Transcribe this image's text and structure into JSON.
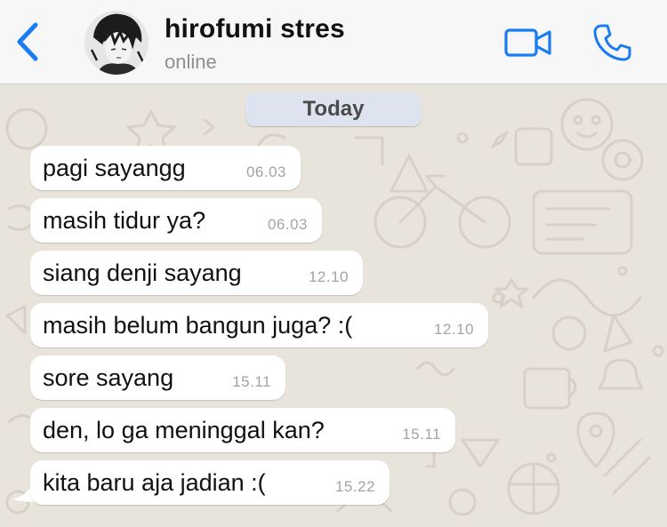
{
  "header": {
    "contact_name": "hirofumi stres",
    "status": "online",
    "accent": "#1a7cf2"
  },
  "icons": {
    "back": "chevron-left-icon",
    "video": "video-camera-icon",
    "call": "phone-icon"
  },
  "chat": {
    "date_label": "Today",
    "bubble_color": "#ffffff",
    "wallpaper_color": "#e9e4db",
    "messages": [
      {
        "text": "pagi sayangg",
        "time": "06.03"
      },
      {
        "text": "masih tidur ya?",
        "time": "06.03"
      },
      {
        "text": "siang denji sayang",
        "time": "12.10"
      },
      {
        "text": "masih belum bangun juga? :(",
        "time": "12.10"
      },
      {
        "text": "sore sayang",
        "time": "15.11"
      },
      {
        "text": "den, lo ga meninggal kan?",
        "time": "15.11"
      },
      {
        "text": "kita baru aja jadian :(",
        "time": "15.22"
      }
    ]
  }
}
